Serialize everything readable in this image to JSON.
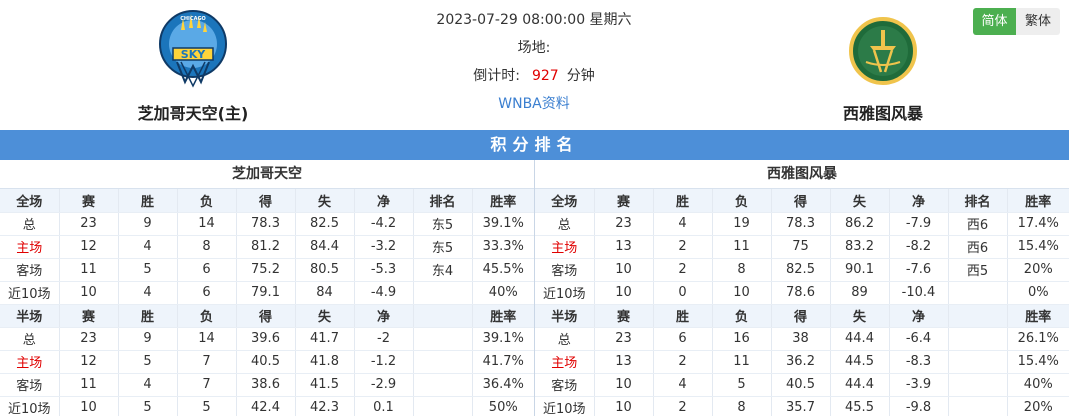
{
  "home_team": {
    "name": "芝加哥天空(主)",
    "logo_text": "SKY",
    "logo_ring_text": "CHICAGO"
  },
  "away_team": {
    "name": "西雅图风暴"
  },
  "match": {
    "datetime": "2023-07-29 08:00:00 星期六",
    "venue_label": "场地:",
    "countdown_label": "倒计时:",
    "countdown_value": "927",
    "countdown_unit": "分钟",
    "link_label": "WNBA资料"
  },
  "lang": {
    "simplified": "简体",
    "traditional": "繁体"
  },
  "section_title": "积分排名",
  "colors": {
    "accent": "#4d8fd8",
    "lang_active": "#4caf50",
    "highlight": "#e00000",
    "link": "#3b7fd0"
  },
  "tables": [
    {
      "team": "芝加哥天空",
      "full_header": [
        "全场",
        "赛",
        "胜",
        "负",
        "得",
        "失",
        "净",
        "排名",
        "胜率"
      ],
      "full_rows": [
        [
          "总",
          "23",
          "9",
          "14",
          "78.3",
          "82.5",
          "-4.2",
          "东5",
          "39.1%"
        ],
        [
          "主场",
          "12",
          "4",
          "8",
          "81.2",
          "84.4",
          "-3.2",
          "东5",
          "33.3%"
        ],
        [
          "客场",
          "11",
          "5",
          "6",
          "75.2",
          "80.5",
          "-5.3",
          "东4",
          "45.5%"
        ],
        [
          "近10场",
          "10",
          "4",
          "6",
          "79.1",
          "84",
          "-4.9",
          "",
          "40%"
        ]
      ],
      "half_header": [
        "半场",
        "赛",
        "胜",
        "负",
        "得",
        "失",
        "净",
        "",
        "胜率"
      ],
      "half_rows": [
        [
          "总",
          "23",
          "9",
          "14",
          "39.6",
          "41.7",
          "-2",
          "",
          "39.1%"
        ],
        [
          "主场",
          "12",
          "5",
          "7",
          "40.5",
          "41.8",
          "-1.2",
          "",
          "41.7%"
        ],
        [
          "客场",
          "11",
          "4",
          "7",
          "38.6",
          "41.5",
          "-2.9",
          "",
          "36.4%"
        ],
        [
          "近10场",
          "10",
          "5",
          "5",
          "42.4",
          "42.3",
          "0.1",
          "",
          "50%"
        ]
      ]
    },
    {
      "team": "西雅图风暴",
      "full_header": [
        "全场",
        "赛",
        "胜",
        "负",
        "得",
        "失",
        "净",
        "排名",
        "胜率"
      ],
      "full_rows": [
        [
          "总",
          "23",
          "4",
          "19",
          "78.3",
          "86.2",
          "-7.9",
          "西6",
          "17.4%"
        ],
        [
          "主场",
          "13",
          "2",
          "11",
          "75",
          "83.2",
          "-8.2",
          "西6",
          "15.4%"
        ],
        [
          "客场",
          "10",
          "2",
          "8",
          "82.5",
          "90.1",
          "-7.6",
          "西5",
          "20%"
        ],
        [
          "近10场",
          "10",
          "0",
          "10",
          "78.6",
          "89",
          "-10.4",
          "",
          "0%"
        ]
      ],
      "half_header": [
        "半场",
        "赛",
        "胜",
        "负",
        "得",
        "失",
        "净",
        "",
        "胜率"
      ],
      "half_rows": [
        [
          "总",
          "23",
          "6",
          "16",
          "38",
          "44.4",
          "-6.4",
          "",
          "26.1%"
        ],
        [
          "主场",
          "13",
          "2",
          "11",
          "36.2",
          "44.5",
          "-8.3",
          "",
          "15.4%"
        ],
        [
          "客场",
          "10",
          "4",
          "5",
          "40.5",
          "44.4",
          "-3.9",
          "",
          "40%"
        ],
        [
          "近10场",
          "10",
          "2",
          "8",
          "35.7",
          "45.5",
          "-9.8",
          "",
          "20%"
        ]
      ]
    }
  ]
}
